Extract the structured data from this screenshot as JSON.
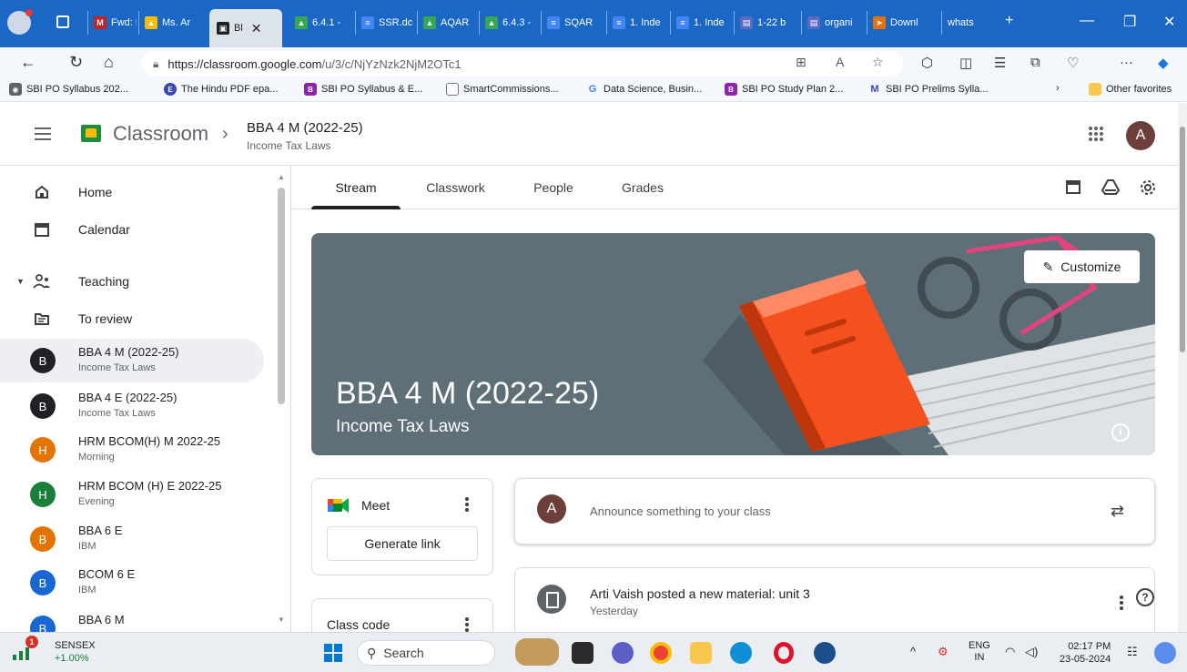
{
  "browser": {
    "tabs": [
      {
        "label": "",
        "icon": "outlook-icon"
      },
      {
        "label": "Fwd: M",
        "icon": "gmail-icon"
      },
      {
        "label": "Ms. Ar",
        "icon": "drive-icon"
      },
      {
        "label": "Bl",
        "icon": "classroom-icon",
        "active": true
      },
      {
        "label": "6.4.1 -",
        "icon": "drive-icon"
      },
      {
        "label": "SSR.dc",
        "icon": "docs-icon"
      },
      {
        "label": "AQAR",
        "icon": "drive-icon"
      },
      {
        "label": "6.4.3 -",
        "icon": "drive-icon"
      },
      {
        "label": "SQAR",
        "icon": "docs-icon"
      },
      {
        "label": "1. Inde",
        "icon": "docs-icon"
      },
      {
        "label": "1. Inde",
        "icon": "docs-icon"
      },
      {
        "label": "1-22 b",
        "icon": "pdf-icon"
      },
      {
        "label": "organi",
        "icon": "pdf-icon"
      },
      {
        "label": "Downl",
        "icon": "download-icon"
      },
      {
        "label": "whats",
        "icon": "whatsapp-icon"
      }
    ],
    "url_host": "https://classroom.google.com",
    "url_path": "/u/3/c/NjYzNzk2NjM2OTc1",
    "bookmarks": [
      {
        "label": "SBI PO Syllabus 202...",
        "color": "#5f6368"
      },
      {
        "label": "The Hindu PDF epa...",
        "color": "#3949ab"
      },
      {
        "label": "SBI PO Syllabus & E...",
        "color": "#8e24aa"
      },
      {
        "label": "SmartCommissions...",
        "color": "#5f6368"
      },
      {
        "label": "Data Science, Busin...",
        "color": "#4285f4"
      },
      {
        "label": "SBI PO Study Plan 2...",
        "color": "#8e24aa"
      },
      {
        "label": "SBI PO Prelims Sylla...",
        "color": "#3949ab"
      }
    ],
    "other_favorites": "Other favorites"
  },
  "header": {
    "app_name": "Classroom",
    "class_title": "BBA 4 M (2022-25)",
    "class_subtitle": "Income Tax Laws",
    "avatar_letter": "A"
  },
  "sidebar": {
    "items": [
      {
        "label": "Home"
      },
      {
        "label": "Calendar"
      },
      {
        "label": "Teaching"
      },
      {
        "label": "To review"
      }
    ],
    "classes": [
      {
        "letter": "B",
        "name": "BBA 4 M (2022-25)",
        "sub": "Income Tax Laws",
        "color": "#202124",
        "selected": true
      },
      {
        "letter": "B",
        "name": "BBA 4 E (2022-25)",
        "sub": "Income Tax Laws",
        "color": "#202124"
      },
      {
        "letter": "H",
        "name": "HRM BCOM(H) M 2022-25",
        "sub": "Morning",
        "color": "#e37400"
      },
      {
        "letter": "H",
        "name": "HRM BCOM (H) E 2022-25",
        "sub": "Evening",
        "color": "#188038"
      },
      {
        "letter": "B",
        "name": "BBA 6 E",
        "sub": "IBM",
        "color": "#e37400"
      },
      {
        "letter": "B",
        "name": "BCOM 6 E",
        "sub": "IBM",
        "color": "#1967d2"
      },
      {
        "letter": "B",
        "name": "BBA 6 M",
        "sub": "",
        "color": "#1967d2"
      }
    ]
  },
  "main": {
    "tabs": [
      {
        "label": "Stream"
      },
      {
        "label": "Classwork"
      },
      {
        "label": "People"
      },
      {
        "label": "Grades"
      }
    ],
    "banner": {
      "title": "BBA 4 M (2022-25)",
      "subtitle": "Income Tax Laws",
      "customize": "Customize"
    },
    "meet": {
      "title": "Meet",
      "button": "Generate link"
    },
    "class_code": {
      "title": "Class code"
    },
    "announce": {
      "avatar_letter": "A",
      "placeholder": "Announce something to your class"
    },
    "post": {
      "title": "Arti Vaish posted a new material: unit 3",
      "time": "Yesterday"
    }
  },
  "taskbar": {
    "sensex_badge": "1",
    "sensex_name": "SENSEX",
    "sensex_change": "+1.00%",
    "search": "Search",
    "lang_top": "ENG",
    "lang_bottom": "IN",
    "time": "02:17 PM",
    "date": "23-05-2024"
  }
}
